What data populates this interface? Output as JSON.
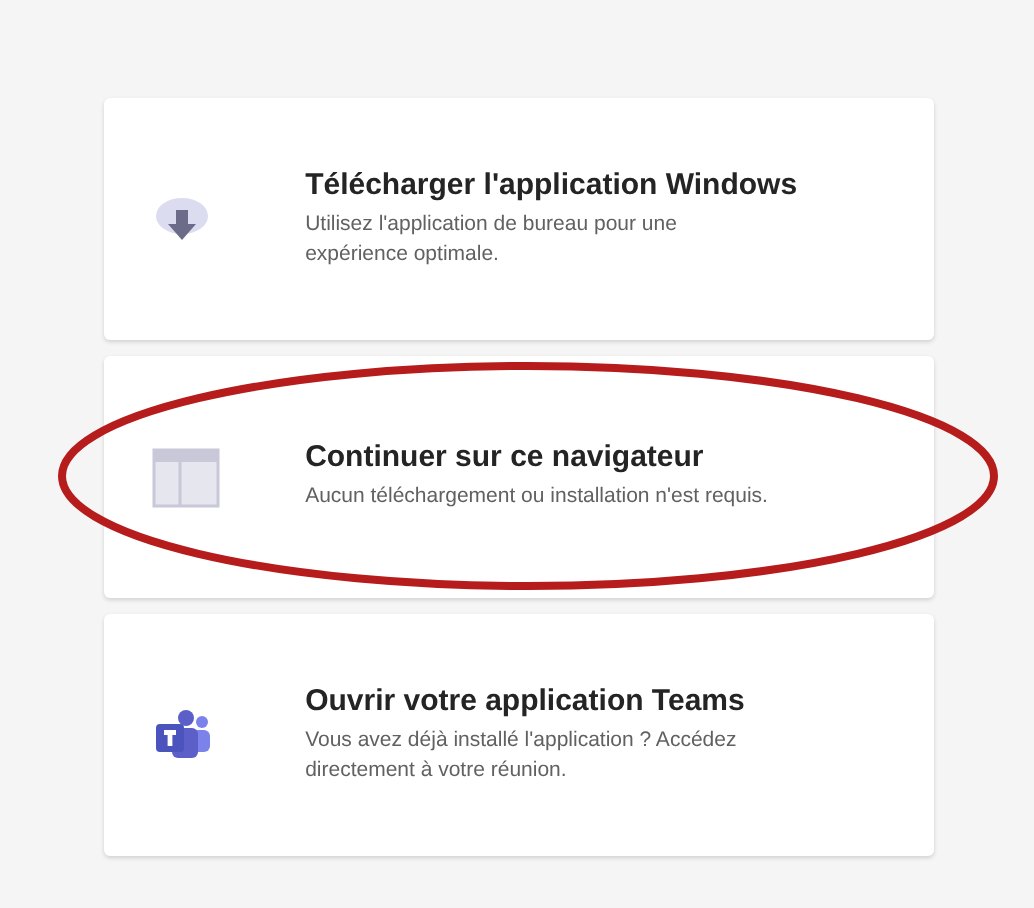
{
  "options": [
    {
      "kind": "download",
      "title": "Télécharger l'application Windows",
      "description": "Utilisez l'application de bureau pour une expérience optimale.",
      "highlighted": false
    },
    {
      "kind": "browser",
      "title": "Continuer sur ce navigateur",
      "description": "Aucun téléchargement ou installation n'est requis.",
      "highlighted": true
    },
    {
      "kind": "teams",
      "title": "Ouvrir votre application Teams",
      "description": "Vous avez déjà installé l'application ? Accédez directement à votre réunion.",
      "highlighted": false
    }
  ]
}
